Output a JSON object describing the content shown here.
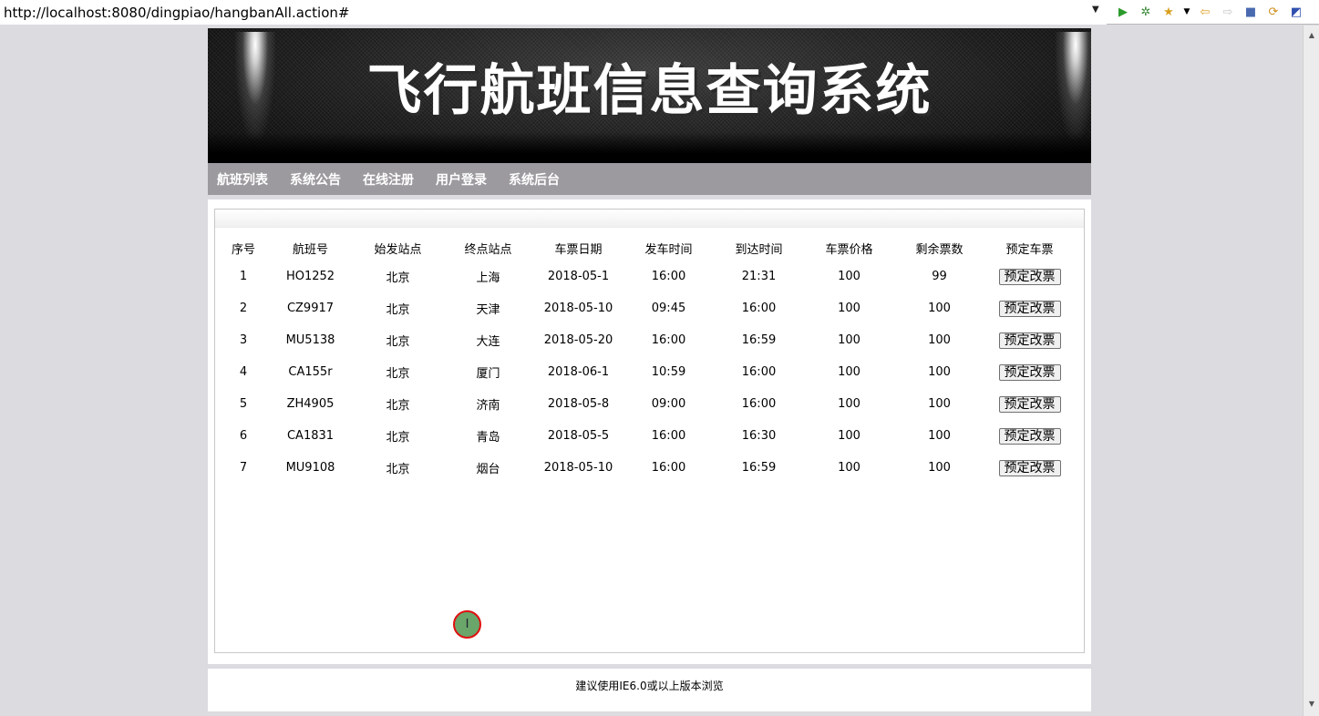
{
  "browser": {
    "url": "http://localhost:8080/dingpiao/hangbanAll.action#",
    "toolbar_icons": [
      "dropdown-arrow-icon",
      "run-icon",
      "debug-icon",
      "favorites-icon",
      "favorites-dropdown-icon",
      "back-icon",
      "forward-icon",
      "stop-icon",
      "refresh-icon",
      "perspective-icon"
    ]
  },
  "banner": {
    "title": "飞行航班信息查询系统"
  },
  "nav": {
    "items": [
      "航班列表",
      "系统公告",
      "在线注册",
      "用户登录",
      "系统后台"
    ]
  },
  "table": {
    "headers": [
      "序号",
      "航班号",
      "始发站点",
      "终点站点",
      "车票日期",
      "发车时间",
      "到达时间",
      "车票价格",
      "剩余票数",
      "预定车票"
    ],
    "rows": [
      {
        "no": "1",
        "flight": "HO1252",
        "from": "北京",
        "to": "上海",
        "date": "2018-05-1",
        "depart": "16:00",
        "arrive": "21:31",
        "price": "100",
        "remaining": "99",
        "action": "预定改票"
      },
      {
        "no": "2",
        "flight": "CZ9917",
        "from": "北京",
        "to": "天津",
        "date": "2018-05-10",
        "depart": "09:45",
        "arrive": "16:00",
        "price": "100",
        "remaining": "100",
        "action": "预定改票"
      },
      {
        "no": "3",
        "flight": "MU5138",
        "from": "北京",
        "to": "大连",
        "date": "2018-05-20",
        "depart": "16:00",
        "arrive": "16:59",
        "price": "100",
        "remaining": "100",
        "action": "预定改票"
      },
      {
        "no": "4",
        "flight": "CA155r",
        "from": "北京",
        "to": "厦门",
        "date": "2018-06-1",
        "depart": "10:59",
        "arrive": "16:00",
        "price": "100",
        "remaining": "100",
        "action": "预定改票"
      },
      {
        "no": "5",
        "flight": "ZH4905",
        "from": "北京",
        "to": "济南",
        "date": "2018-05-8",
        "depart": "09:00",
        "arrive": "16:00",
        "price": "100",
        "remaining": "100",
        "action": "预定改票"
      },
      {
        "no": "6",
        "flight": "CA1831",
        "from": "北京",
        "to": "青岛",
        "date": "2018-05-5",
        "depart": "16:00",
        "arrive": "16:30",
        "price": "100",
        "remaining": "100",
        "action": "预定改票"
      },
      {
        "no": "7",
        "flight": "MU9108",
        "from": "北京",
        "to": "烟台",
        "date": "2018-05-10",
        "depart": "16:00",
        "arrive": "16:59",
        "price": "100",
        "remaining": "100",
        "action": "预定改票"
      }
    ]
  },
  "footer": {
    "text": "建议使用IE6.0或以上版本浏览"
  },
  "colors": {
    "page_bg": "#dcdbe0",
    "nav_bg": "#9c9a9f",
    "banner_bg": "#1c1c1c",
    "cursor_marker": "#6aa56a",
    "cursor_ring": "#e01010"
  }
}
